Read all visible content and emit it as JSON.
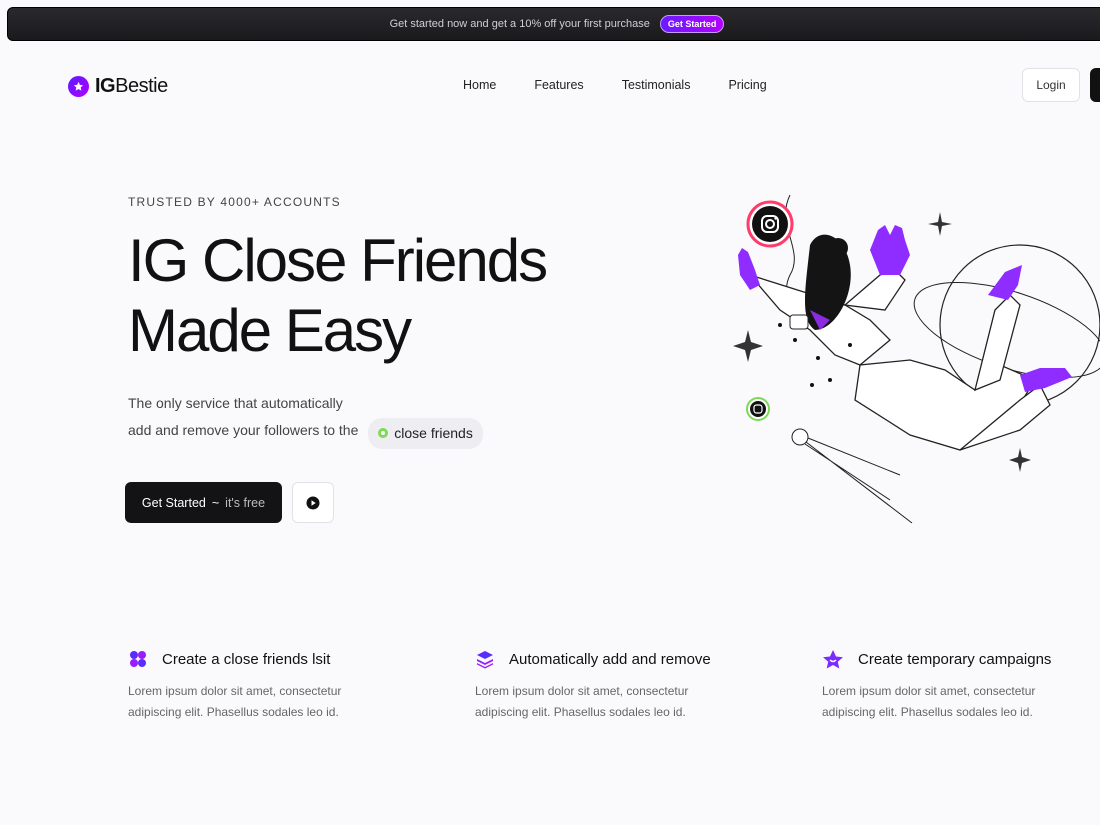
{
  "topbar": {
    "text": "Get started now and get a 10% off your first purchase",
    "button": "Get Started"
  },
  "nav": {
    "logo_bold": "IG",
    "logo_rest": "Bestie",
    "links": [
      "Home",
      "Features",
      "Testimonials",
      "Pricing"
    ],
    "login": "Login"
  },
  "hero": {
    "eyebrow": "TRUSTED BY 4000+ ACCOUNTS",
    "headline_line1": "IG Close Friends",
    "headline_line2": "Made Easy",
    "sub_line1": "The only service that automatically",
    "sub_line2": "add and remove your followers to the",
    "pill": "close friends",
    "cta_main": "Get Started",
    "cta_sep": "~",
    "cta_free": "it's free"
  },
  "features": [
    {
      "icon": "grid-icon",
      "title": "Create a close friends lsit",
      "desc_line1": "Lorem ipsum dolor sit amet, consectetur",
      "desc_line2": "adipiscing elit. Phasellus sodales leo id."
    },
    {
      "icon": "layers-icon",
      "title": "Automatically add and remove",
      "desc_line1": "Lorem ipsum dolor sit amet, consectetur",
      "desc_line2": "adipiscing elit. Phasellus sodales leo id."
    },
    {
      "icon": "star-badge-icon",
      "title": "Create temporary campaigns",
      "desc_line1": "Lorem ipsum dolor sit amet, consectetur",
      "desc_line2": "adipiscing elit. Phasellus sodales leo id."
    }
  ],
  "colors": {
    "accent": "#7b2bff",
    "accent2": "#b000ff",
    "dark": "#131316",
    "green": "#7ed957"
  }
}
